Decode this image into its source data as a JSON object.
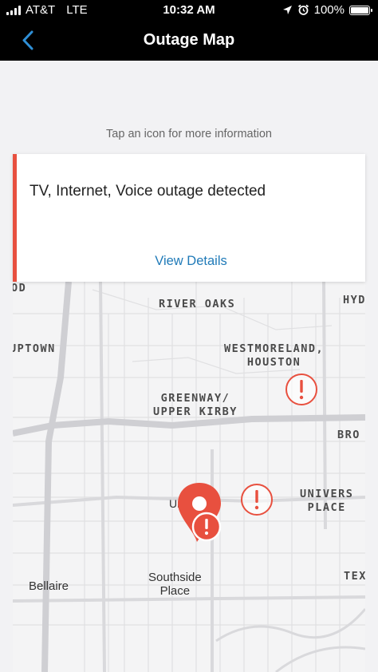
{
  "status_bar": {
    "carrier": "AT&T",
    "network": "LTE",
    "time": "10:32 AM",
    "battery": "100%",
    "battery_level": 1.0,
    "icons": [
      "signal-icon",
      "location-arrow-icon",
      "alarm-icon",
      "battery-icon"
    ]
  },
  "nav": {
    "title": "Outage Map",
    "back_icon": "chevron-left-icon"
  },
  "hint": "Tap an icon for more information",
  "card": {
    "title": "TV, Internet, Voice outage detected",
    "link": "View Details",
    "accent_color": "#e8503f"
  },
  "map": {
    "labels": {
      "od": "OD",
      "river_oaks": "RIVER OAKS",
      "hyd": "HYD",
      "uptown": "UPTOWN",
      "westmoreland": "WESTMORELAND,\nHOUSTON",
      "greenway": "GREENWAY/\nUPPER KIRBY",
      "bro": "BRO",
      "university_place": "UNIVERS\nPLACE",
      "university": "University",
      "bellaire": "Bellaire",
      "southside_place": "Southside\nPlace",
      "tex": "TEX"
    },
    "marker_icon": "exclamation-circle-icon",
    "pin_icon": "location-pin-icon",
    "marker_color": "#e8503f"
  }
}
